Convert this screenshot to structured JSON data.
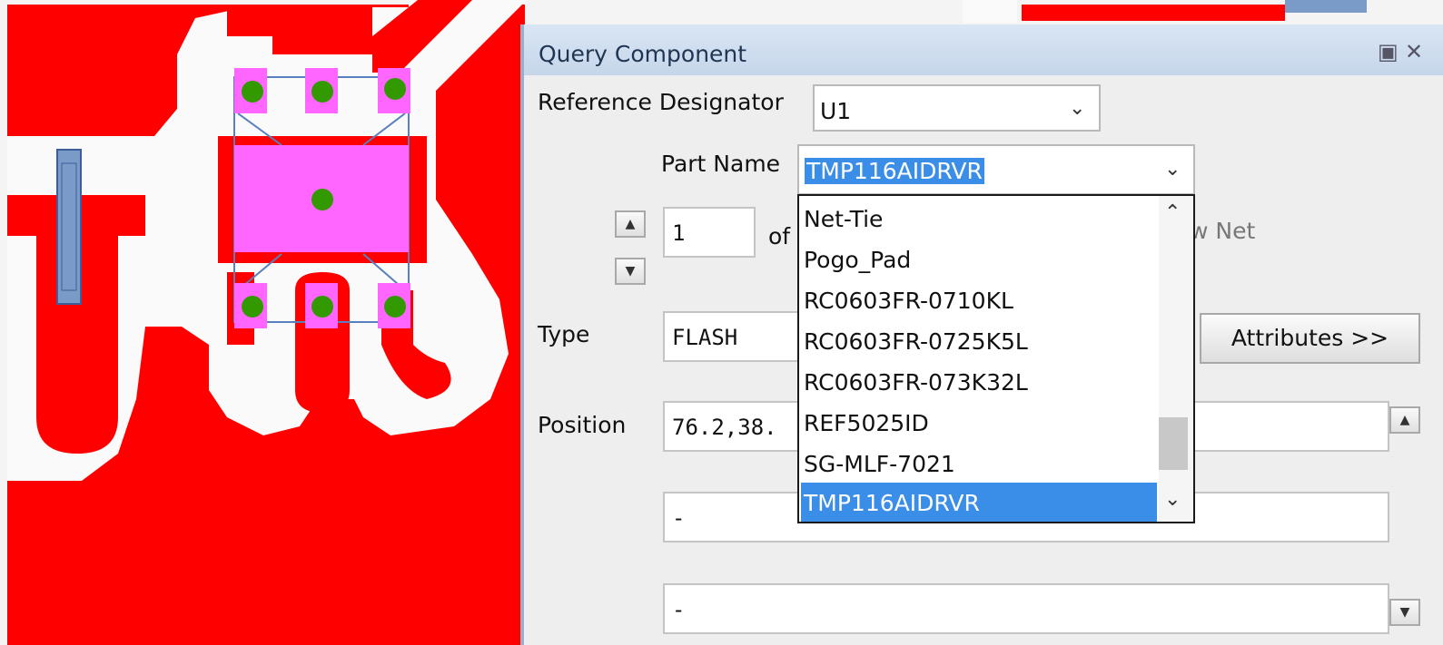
{
  "dialog": {
    "title": "Query Component",
    "restore_icon": "▣",
    "close_icon": "✕"
  },
  "form": {
    "ref_des_label": "Reference Designator",
    "ref_des_value": "U1",
    "part_name_label": "Part Name",
    "part_name_value": "TMP116AIDRVR",
    "index_value": "1",
    "of_label": "of",
    "view_net_label": "w Net",
    "type_label": "Type",
    "type_value": "FLASH",
    "attributes_button": "Attributes >>",
    "position_label": "Position",
    "position_value": "76.2,38.",
    "field_a_value": "-",
    "field_b_value": "-"
  },
  "part_dropdown": {
    "items": [
      "Net-Tie",
      "Pogo_Pad",
      "RC0603FR-0710KL",
      "RC0603FR-0725K5L",
      "RC0603FR-073K32L",
      "REF5025ID",
      "SG-MLF-7021",
      "TMP116AIDRVR"
    ],
    "selected": "TMP116AIDRVR"
  },
  "colors": {
    "copper": "#ff0000",
    "clearance": "#fafafa",
    "pad": "#ff66ff",
    "via": "#339900",
    "selection_blue": "#3b8ee8"
  }
}
